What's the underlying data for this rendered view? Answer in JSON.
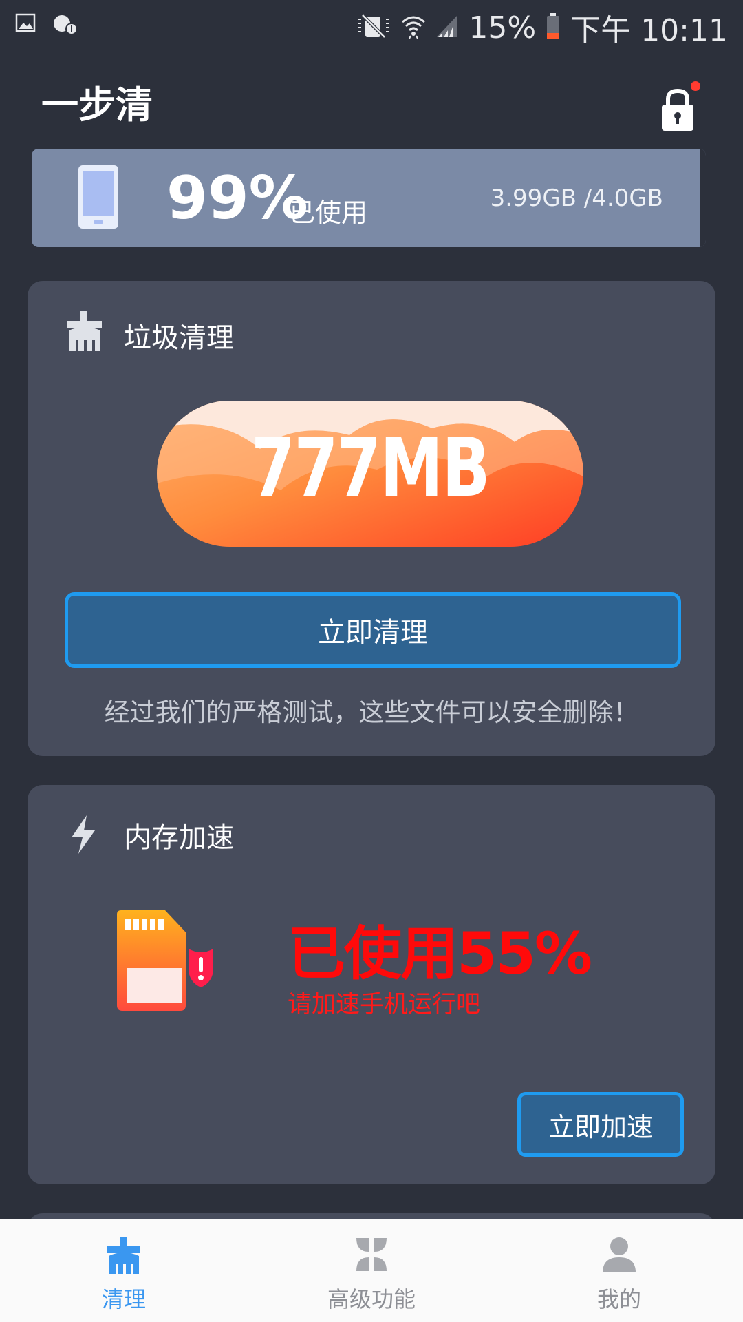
{
  "status_bar": {
    "battery": "15%",
    "time": "下午 10:11",
    "icons": [
      "gallery-icon",
      "notification-badge-icon",
      "mute-icon",
      "wifi-icon",
      "signal-icon",
      "battery-icon"
    ]
  },
  "header": {
    "title": "一步清",
    "lock_icon": "lock-icon"
  },
  "storage": {
    "percent": "99%",
    "used_label": "已使用",
    "size": "3.99GB /4.0GB"
  },
  "junk_clean": {
    "title": "垃圾清理",
    "amount": "777MB",
    "button": "立即清理",
    "note": "经过我们的严格测试，这些文件可以安全删除！"
  },
  "memory": {
    "title": "内存加速",
    "usage": "已使用55%",
    "hint": "请加速手机运行吧",
    "button": "立即加速"
  },
  "bottom_nav": {
    "items": [
      {
        "label": "清理",
        "active": true
      },
      {
        "label": "高级功能",
        "active": false
      },
      {
        "label": "我的",
        "active": false
      }
    ]
  },
  "colors": {
    "background": "#2c303b",
    "card": "#474c5c",
    "storage_bar": "#7b8aa6",
    "button_fill": "#2e6391",
    "button_border": "#1f9bf0",
    "warning_red": "#ff0a0a",
    "nav_active": "#3a97f0",
    "nav_inactive": "#8d8f95"
  }
}
